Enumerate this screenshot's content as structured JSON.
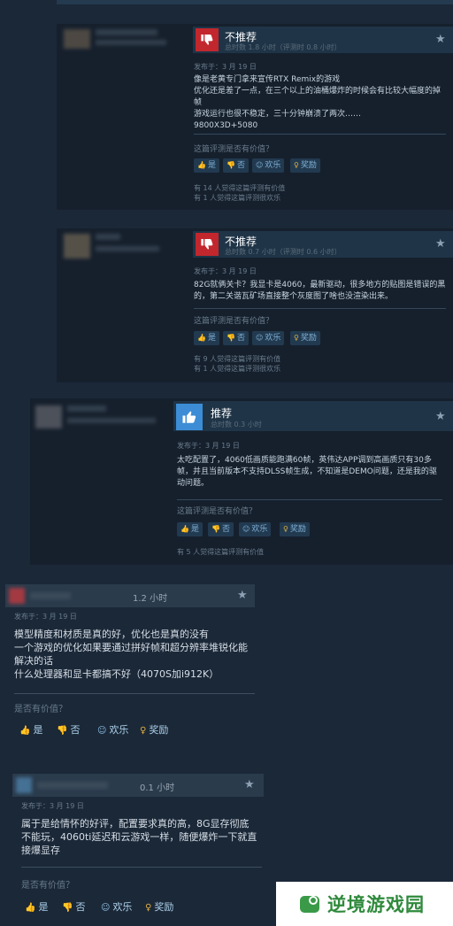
{
  "reviews": [
    {
      "verdict": "不推荐",
      "playtime": "总时数 1.8 小时（评测时 0.8 小时）",
      "date": "发布于：3 月 19 日",
      "text": "像是老黄专门拿来宣传RTX Remix的游戏\n优化还是差了一点，在三个以上的油桶爆炸的时候会有比较大幅度的掉帧\n游戏运行也很不稳定，三十分钟崩溃了两次……\n9800X3D+5080",
      "question": "这篇评测是否有价值？",
      "buttons": [
        "是",
        "否",
        "欢乐",
        "奖励"
      ],
      "stats": "有 14 人觉得这篇评测有价值\n有 1 人觉得这篇评测很欢乐"
    },
    {
      "verdict": "不推荐",
      "playtime": "总时数 0.7 小时（评测时 0.6 小时）",
      "date": "发布于：3 月 19 日",
      "text": "82G就俩关卡？我显卡是4060，最新驱动，很多地方的贴图是错误的黑的，第二关谐瓦矿场直接整个灰度图了啥也没渲染出来。",
      "question": "这篇评测是否有价值？",
      "buttons": [
        "是",
        "否",
        "欢乐",
        "奖励"
      ],
      "stats": "有 9 人觉得这篇评测有价值\n有 1 人觉得这篇评测很欢乐"
    },
    {
      "verdict": "推荐",
      "playtime": "总时数 0.3 小时",
      "date": "发布于：3 月 19 日",
      "text": "太吃配置了，4060低画质能跑满60帧，英伟达APP调到高画质只有30多帧，并且当前版本不支持DLSS帧生成，不知道是DEMO问题，还是我的驱动问题。",
      "question": "这篇评测是否有价值？",
      "buttons": [
        "是",
        "否",
        "欢乐",
        "奖励"
      ],
      "stats": "有 5 人觉得这篇评测有价值"
    },
    {
      "hours": "1.2 小时",
      "date": "发布于：3 月 19 日",
      "text": "模型精度和材质是真的好，优化也是真的没有\n一个游戏的优化如果要通过拼好帧和超分辨率堆锐化能解决的话\n什么处理器和显卡都搞不好（4070S加i912K）",
      "question": "是否有价值？",
      "buttons": [
        "是",
        "否",
        "欢乐",
        "奖励"
      ]
    },
    {
      "hours": "0.1 小时",
      "date": "发布于：3 月 19 日",
      "text": "属于是给情怀的好评，配置要求真的高，8G显存彻底不能玩，4060ti延迟和云游戏一样，随便爆炸一下就直接爆显存",
      "question": "是否有价值？",
      "buttons": [
        "是",
        "否",
        "欢乐",
        "奖励"
      ]
    }
  ],
  "watermark": "逆境游戏园",
  "colors": {
    "negative": "#c2272d",
    "positive": "#3c8dd6",
    "background": "#1b2838"
  }
}
